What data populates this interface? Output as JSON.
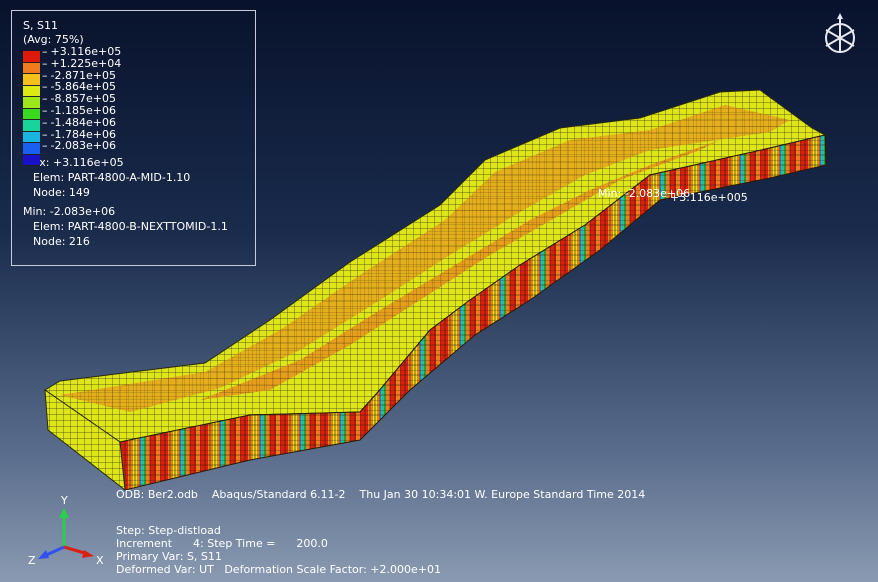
{
  "legend": {
    "title": "S, S11",
    "avg": "(Avg: 75%)",
    "colors": [
      "#e01a0a",
      "#f07c1c",
      "#f4c01c",
      "#dcea14",
      "#9ee81a",
      "#3ad81e",
      "#18d49a",
      "#1ab4e0",
      "#1a60f0",
      "#1a10c8"
    ],
    "labels": [
      "+3.116e+05",
      "+1.225e+04",
      "-2.871e+05",
      "-5.864e+05",
      "-8.857e+05",
      "-1.185e+06",
      "-1.484e+06",
      "-1.784e+06",
      "-2.083e+06"
    ],
    "max_label": "Max: +3.116e+05",
    "max_elem": "Elem: PART-4800-A-MID-1.10",
    "max_node": "Node: 149",
    "min_label": "Min: -2.083e+06",
    "min_elem": "Elem: PART-4800-B-NEXTTOMID-1.1",
    "min_node": "Node: 216"
  },
  "overlay": {
    "min_marker": "Min: -2.083e+06",
    "max_marker": "+3.116e+005"
  },
  "info": {
    "odb_line": "ODB: Ber2.odb    Abaqus/Standard 6.11-2    Thu Jan 30 10:34:01 W. Europe Standard Time 2014",
    "step": "Step: Step-distload",
    "increment": "Increment      4: Step Time =      200.0",
    "primary": "Primary Var: S, S11",
    "deformed": "Deformed Var: UT   Deformation Scale Factor: +2.000e+01"
  },
  "axes": {
    "y": "Y",
    "x": "X",
    "z": "Z"
  }
}
